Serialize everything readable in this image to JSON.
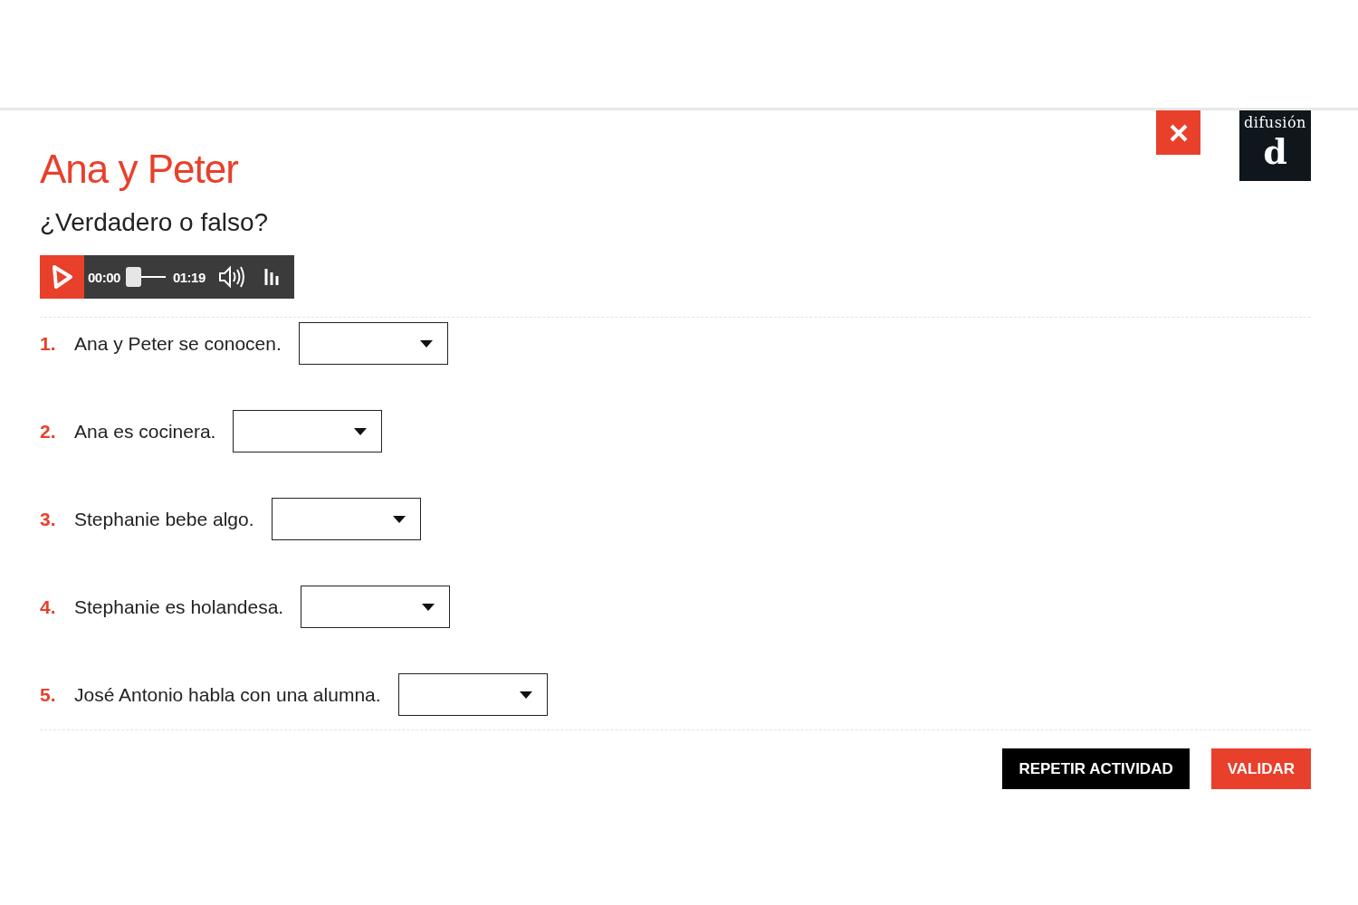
{
  "header": {
    "logo": {
      "wordmark": "difusión",
      "letter": "d"
    }
  },
  "title": "Ana y Peter",
  "instruction": "¿Verdadero o falso?",
  "audio_player": {
    "current_time": "00:00",
    "duration": "01:19",
    "level": 0
  },
  "questions": [
    {
      "number": "1.",
      "text": "Ana y Peter se conocen."
    },
    {
      "number": "2.",
      "text": "Ana es cocinera."
    },
    {
      "number": "3.",
      "text": "Stephanie bebe algo."
    },
    {
      "number": "4.",
      "text": "Stephanie es holandesa."
    },
    {
      "number": "5.",
      "text": "José Antonio habla con una alumna."
    }
  ],
  "buttons": [
    {
      "label": "REPETIR ACTIVIDAD",
      "kind": "secondary"
    },
    {
      "label": "VALIDAR",
      "kind": "primary"
    }
  ]
}
